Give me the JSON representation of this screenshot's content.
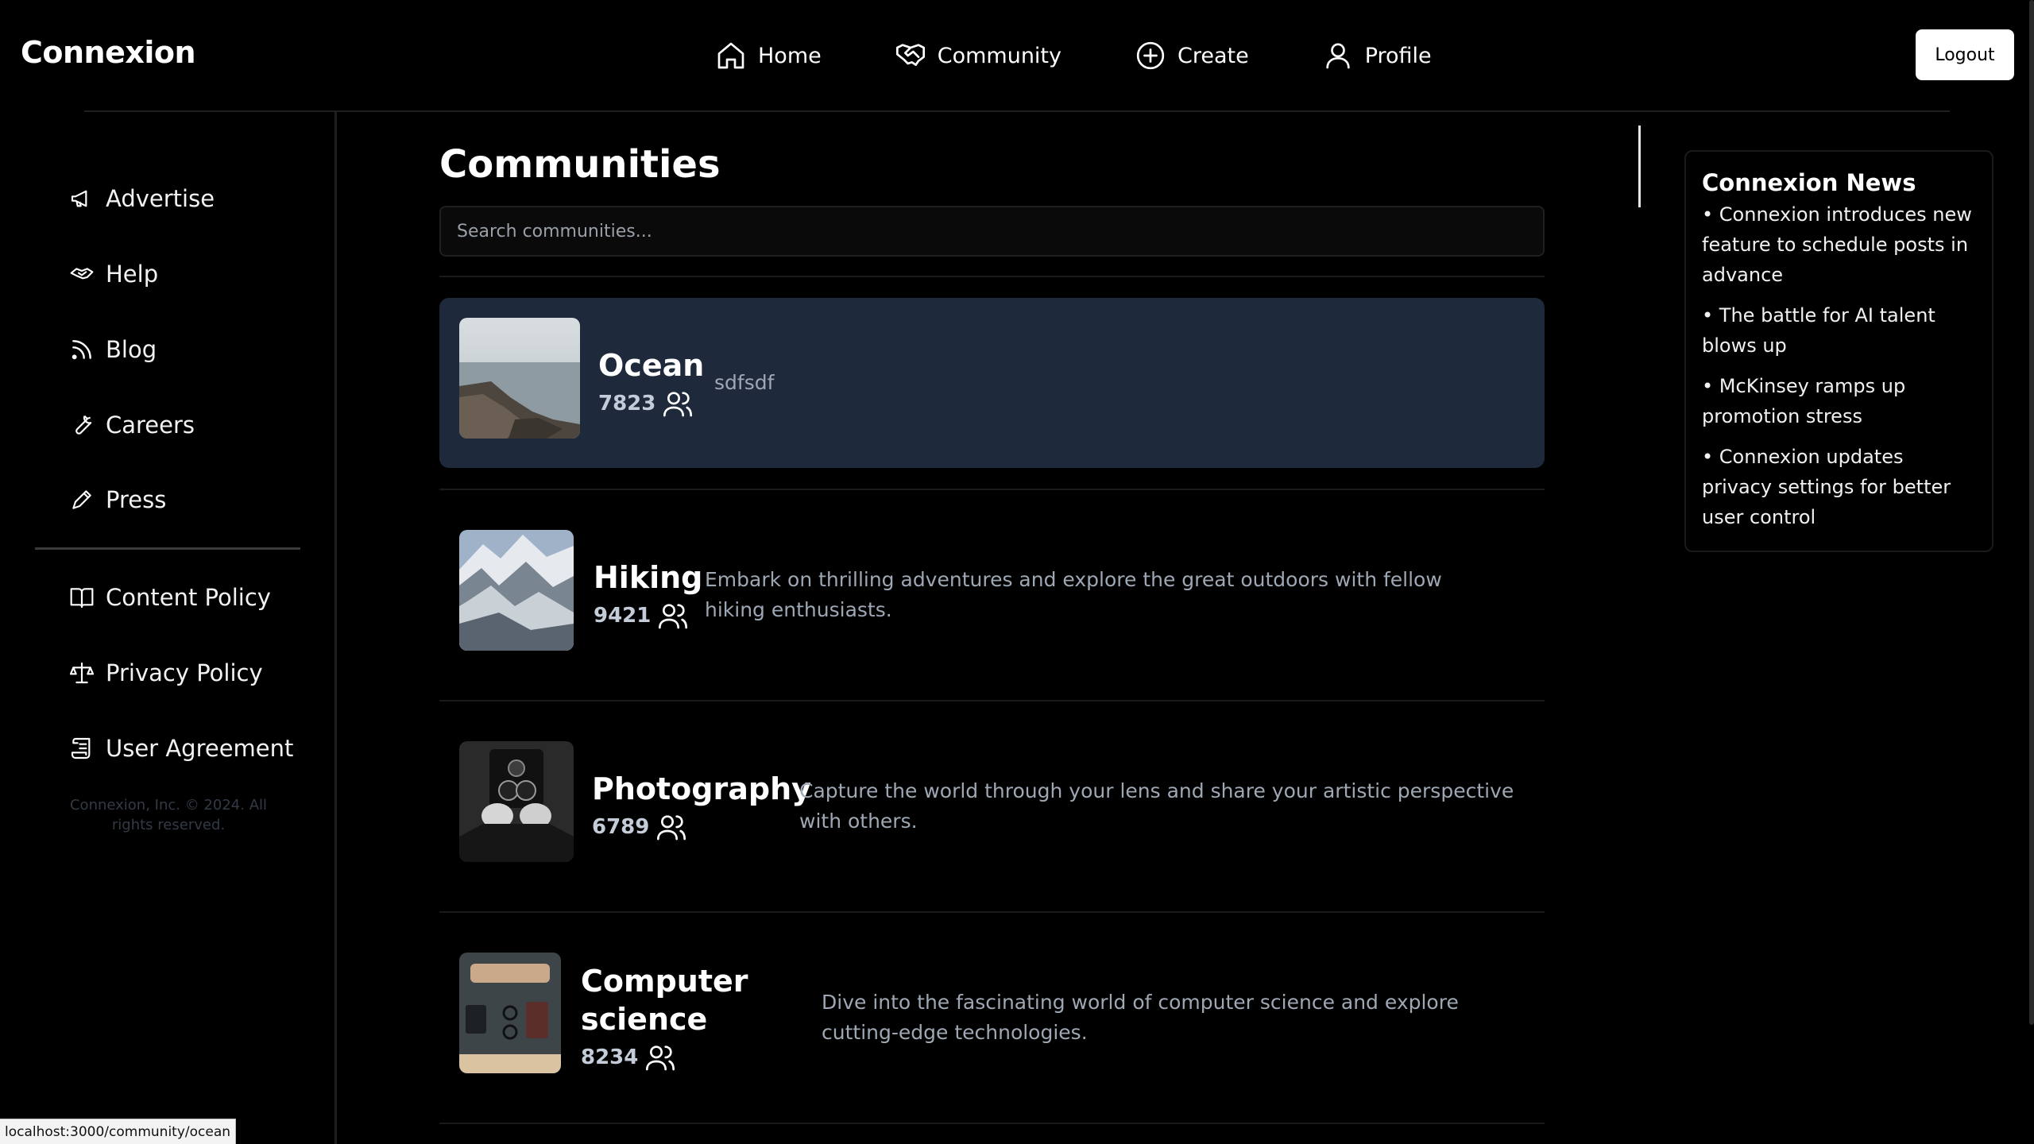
{
  "app": {
    "brand": "Connexion"
  },
  "nav": [
    {
      "label": "Home",
      "icon": "home-icon"
    },
    {
      "label": "Community",
      "icon": "handshake-icon"
    },
    {
      "label": "Create",
      "icon": "plus-circle-icon"
    },
    {
      "label": "Profile",
      "icon": "user-icon"
    }
  ],
  "header": {
    "logout_label": "Logout"
  },
  "sidebar": {
    "items": [
      {
        "label": "Advertise",
        "icon": "megaphone-icon"
      },
      {
        "label": "Help",
        "icon": "handshake-help-icon"
      },
      {
        "label": "Blog",
        "icon": "rss-icon"
      },
      {
        "label": "Careers",
        "icon": "wrench-icon"
      },
      {
        "label": "Press",
        "icon": "pen-icon"
      }
    ],
    "policy_items": [
      {
        "label": "Content Policy",
        "icon": "book-icon"
      },
      {
        "label": "Privacy Policy",
        "icon": "scale-icon"
      },
      {
        "label": "User Agreement",
        "icon": "scroll-icon"
      }
    ],
    "copyright": "Connexion, Inc. © 2024. All rights reserved."
  },
  "main": {
    "title": "Communities",
    "search_placeholder": "Search communities...",
    "communities": [
      {
        "name": "Ocean",
        "members": "7823",
        "description": "sdfsdf",
        "selected": true
      },
      {
        "name": "Hiking",
        "members": "9421",
        "description": "Embark on thrilling adventures and explore the great outdoors with fellow hiking enthusiasts."
      },
      {
        "name": "Photography",
        "members": "6789",
        "description": "Capture the world through your lens and share your artistic perspective with others."
      },
      {
        "name": "Computer science",
        "members": "8234",
        "description": "Dive into the fascinating world of computer science and explore cutting-edge technologies."
      }
    ]
  },
  "news": {
    "title": "Connexion News",
    "items": [
      "Connexion introduces new feature to schedule posts in advance",
      "The battle for AI talent blows up",
      "McKinsey ramps up promotion stress",
      "Connexion updates privacy settings for better user control"
    ]
  },
  "status_bar": {
    "url": "localhost:3000/community/ocean"
  },
  "colors": {
    "background": "#000000",
    "selected_card": "#1e293b",
    "muted_text": "#9ea7b4"
  }
}
